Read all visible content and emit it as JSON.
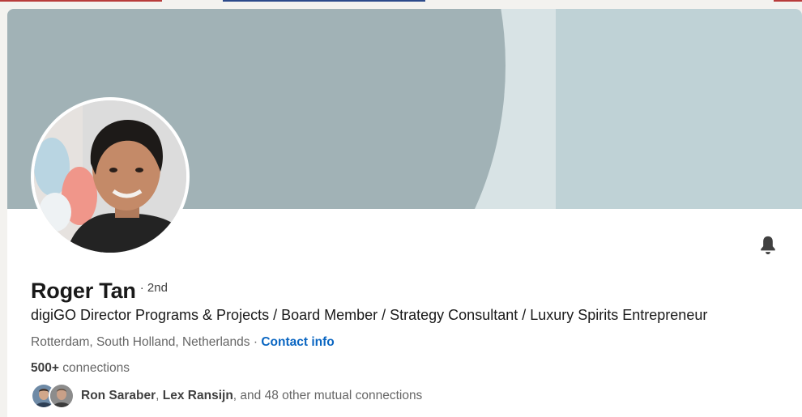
{
  "profile": {
    "name": "Roger Tan",
    "degree": "· 2nd",
    "headline": "digiGO Director Programs & Projects / Board Member / Strategy Consultant / Luxury Spirits Entrepreneur",
    "location": "Rotterdam, South Holland, Netherlands",
    "separator": " · ",
    "contact_info_label": "Contact info",
    "connections_count": "500+",
    "connections_label": " connections"
  },
  "mutual": {
    "first": "Ron Saraber",
    "comma": ", ",
    "second": "Lex Ransijn",
    "rest": ", and 48 other mutual connections"
  },
  "icons": {
    "bell": "bell-icon"
  },
  "colors": {
    "link": "#0a66c2",
    "banner_dark": "#a1b2b6",
    "banner_light": "#bfd2d6",
    "banner_mid": "#d8e3e5"
  }
}
